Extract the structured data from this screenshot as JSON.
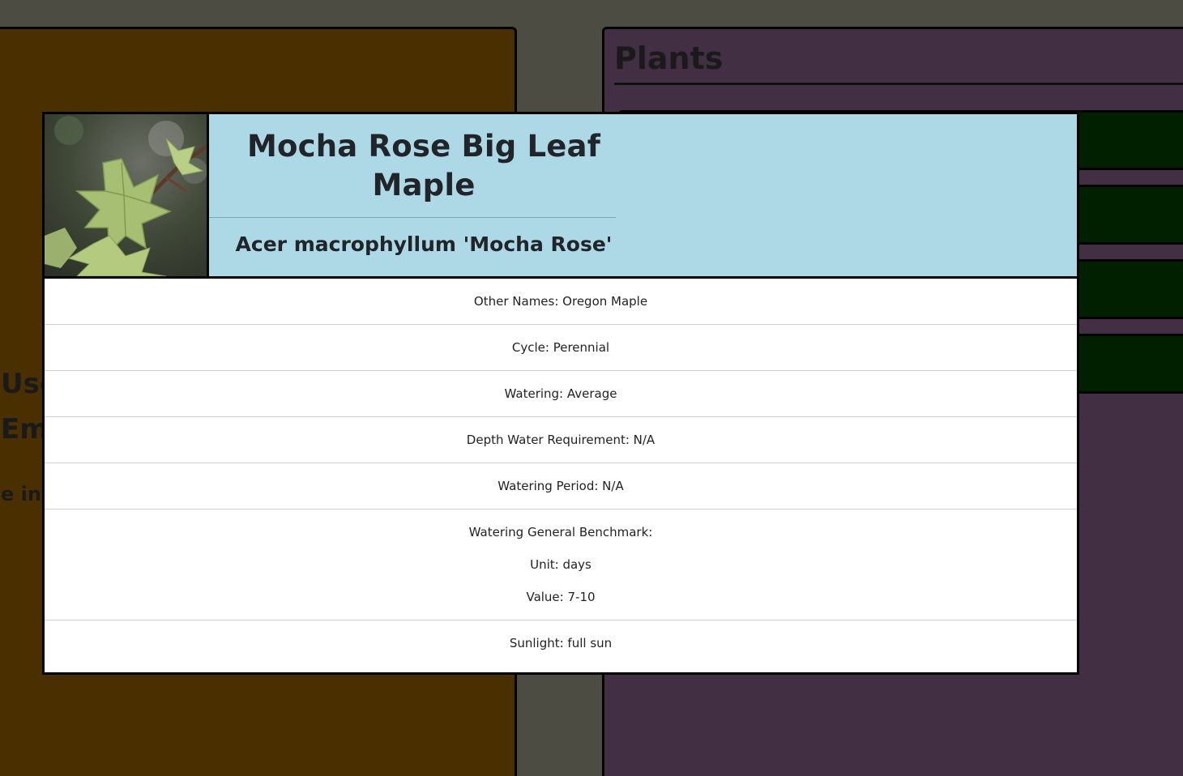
{
  "background": {
    "user_panel": {
      "line_user": "User",
      "line_email": "Email",
      "line_info": "e info"
    },
    "plants_panel": {
      "title": "Plants",
      "cards": [
        {
          "id": 1
        },
        {
          "id": 2
        },
        {
          "id": 3
        },
        {
          "id": 4
        }
      ]
    }
  },
  "modal": {
    "common_name": "Mocha Rose Big Leaf Maple",
    "scientific_name": "Acer macrophyllum 'Mocha Rose'",
    "photo_icon": "plant-photo-maple-leaves",
    "details": {
      "other_names": "Other Names: Oregon Maple",
      "cycle": "Cycle: Perennial",
      "watering": "Watering: Average",
      "depth_water": "Depth Water Requirement: N/A",
      "watering_period": "Watering Period: N/A",
      "benchmark_title": "Watering General Benchmark:",
      "benchmark_unit": "Unit: days",
      "benchmark_value": "Value: 7-10",
      "sunlight": "Sunlight: full sun"
    }
  },
  "colors": {
    "page_bg": "#4c4c42",
    "user_panel_bg": "#4a3000",
    "plants_panel_bg": "#432f44",
    "plant_card_bg": "#002000",
    "modal_header_bg": "#add8e6",
    "modal_body_bg": "#ffffff"
  }
}
